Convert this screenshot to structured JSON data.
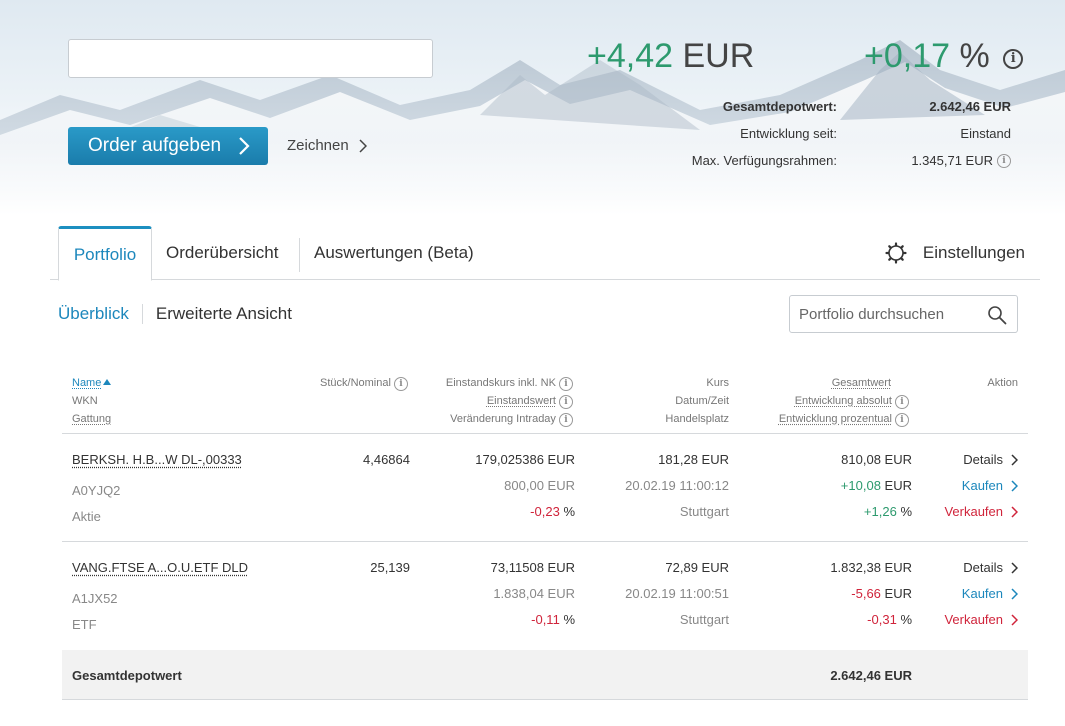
{
  "header": {
    "order_button": "Order aufgeben",
    "zeichnen_link": "Zeichnen",
    "change_eur_value": "+4,42",
    "change_eur_unit": "EUR",
    "change_pct_value": "+0,17",
    "change_pct_unit": "%",
    "summary": [
      {
        "label": "Gesamtdepotwert:",
        "value": "2.642,46 EUR",
        "bold": true
      },
      {
        "label": "Entwicklung seit:",
        "value": "Einstand"
      },
      {
        "label": "Max. Verfügungsrahmen:",
        "value": "1.345,71 EUR"
      }
    ]
  },
  "tabs": {
    "portfolio": "Portfolio",
    "orders": "Orderübersicht",
    "analysis": "Auswertungen (Beta)",
    "settings": "Einstellungen"
  },
  "subnav": {
    "overview": "Überblick",
    "extended": "Erweiterte Ansicht",
    "search_placeholder": "Portfolio durchsuchen"
  },
  "table": {
    "headers": {
      "name": "Name",
      "wkn": "WKN",
      "gattung": "Gattung",
      "stueck": "Stück/Nominal",
      "einstandskurs": "Einstandskurs inkl. NK",
      "einstandswert": "Einstandswert",
      "veraenderung": "Veränderung Intraday",
      "kurs": "Kurs",
      "datum": "Datum/Zeit",
      "handelsplatz": "Handelsplatz",
      "gesamtwert": "Gesamtwert",
      "entw_abs": "Entwicklung absolut",
      "entw_proz": "Entwicklung prozentual",
      "aktion": "Aktion"
    },
    "rows": [
      {
        "name": "BERKSH. H.B...W DL-,00333",
        "wkn": "A0YJQ2",
        "gattung": "Aktie",
        "stueck": "4,46864",
        "einstandskurs": "179,025386 EUR",
        "einstandswert": "800,00 EUR",
        "intraday_value": "-0,23",
        "intraday_unit": "%",
        "kurs": "181,28 EUR",
        "datum": "20.02.19 11:00:12",
        "handelsplatz": "Stuttgart",
        "gesamtwert": "810,08 EUR",
        "entw_abs_value": "+10,08",
        "entw_abs_unit": "EUR",
        "entw_proz_value": "+1,26",
        "entw_proz_unit": "%",
        "details": "Details",
        "buy": "Kaufen",
        "sell": "Verkaufen"
      },
      {
        "name": "VANG.FTSE A...O.U.ETF DLD",
        "wkn": "A1JX52",
        "gattung": "ETF",
        "stueck": "25,139",
        "einstandskurs": "73,11508 EUR",
        "einstandswert": "1.838,04 EUR",
        "intraday_value": "-0,11",
        "intraday_unit": "%",
        "kurs": "72,89 EUR",
        "datum": "20.02.19 11:00:51",
        "handelsplatz": "Stuttgart",
        "gesamtwert": "1.832,38 EUR",
        "entw_abs_value": "-5,66",
        "entw_abs_unit": "EUR",
        "entw_proz_value": "-0,31",
        "entw_proz_unit": "%",
        "details": "Details",
        "buy": "Kaufen",
        "sell": "Verkaufen"
      }
    ],
    "total_label": "Gesamtdepotwert",
    "total_value": "2.642,46 EUR"
  },
  "colors": {
    "accent": "#1c87bc",
    "positive": "#2d9a6e",
    "negative": "#d0243b"
  }
}
